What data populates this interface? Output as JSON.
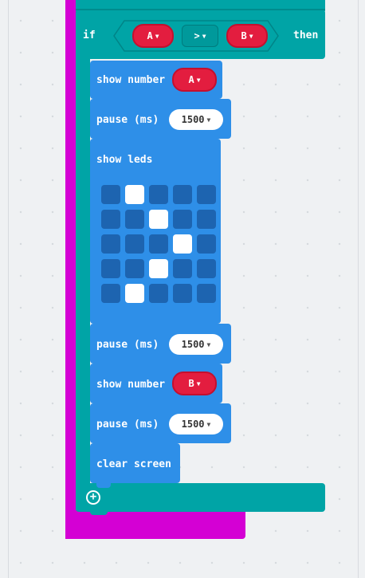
{
  "if_block": {
    "keyword": "if",
    "then_label": "then",
    "left_operand": "A",
    "operator": ">",
    "right_operand": "B"
  },
  "blocks": {
    "show_number_1": {
      "label": "show number",
      "value": "A"
    },
    "pause_1": {
      "label": "pause (ms)",
      "value": "1500"
    },
    "show_leds": {
      "label": "show leds"
    },
    "pause_2": {
      "label": "pause (ms)",
      "value": "1500"
    },
    "show_number_2": {
      "label": "show number",
      "value": "B"
    },
    "pause_3": {
      "label": "pause (ms)",
      "value": "1500"
    },
    "clear_screen": {
      "label": "clear screen"
    }
  },
  "leds": {
    "rows": [
      [
        0,
        1,
        0,
        0,
        0
      ],
      [
        0,
        0,
        1,
        0,
        0
      ],
      [
        0,
        0,
        0,
        1,
        0
      ],
      [
        0,
        0,
        1,
        0,
        0
      ],
      [
        0,
        1,
        0,
        0,
        0
      ]
    ]
  },
  "colors": {
    "outer": "#d400d4",
    "if_block": "#00a4a6",
    "basic_block": "#2e8fe8",
    "variable": "#e31d3f",
    "led_off": "#1d64b0",
    "led_on": "#ffffff",
    "workspace": "#eff1f3"
  },
  "icons": {
    "add": "plus-circle-icon",
    "dropdown": "caret-down-icon"
  }
}
